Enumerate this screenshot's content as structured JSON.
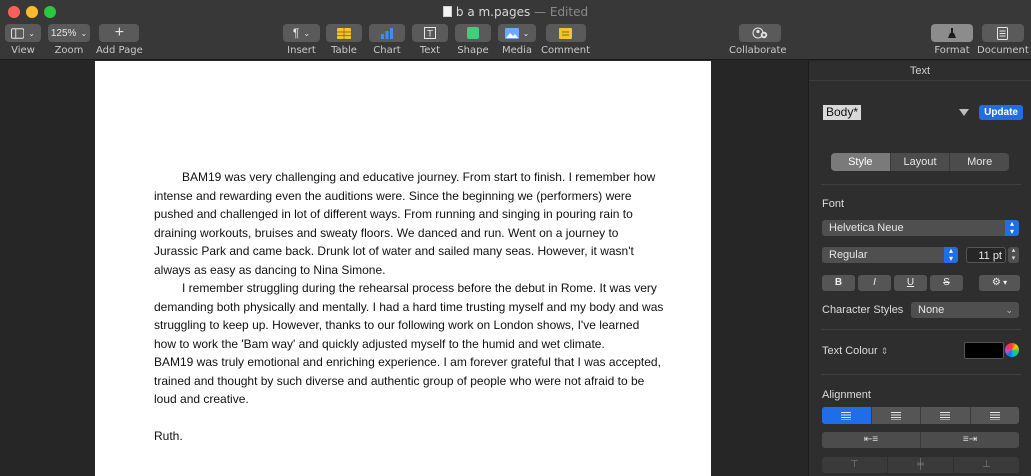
{
  "window": {
    "doc_name": "b a m.pages",
    "status": "— Edited"
  },
  "toolbar": {
    "view": {
      "label": "View",
      "icon": "sidebar-icon"
    },
    "zoom": {
      "label": "Zoom",
      "value": "125%"
    },
    "add_page": {
      "label": "Add Page",
      "icon": "plus-icon"
    },
    "insert": {
      "label": "Insert",
      "icon": "pilcrow-icon"
    },
    "table": {
      "label": "Table",
      "icon": "table-icon"
    },
    "chart": {
      "label": "Chart",
      "icon": "chart-icon"
    },
    "text": {
      "label": "Text",
      "icon": "text-box-icon"
    },
    "shape": {
      "label": "Shape",
      "icon": "shape-icon"
    },
    "media": {
      "label": "Media",
      "icon": "photo-icon"
    },
    "comment": {
      "label": "Comment",
      "icon": "comment-icon"
    },
    "collaborate": {
      "label": "Collaborate",
      "icon": "add-person-icon"
    },
    "format": {
      "label": "Format",
      "icon": "paintbrush-icon"
    },
    "document": {
      "label": "Document",
      "icon": "document-icon"
    }
  },
  "document": {
    "paragraphs": [
      {
        "text": "BAM19 was very challenging and educative journey. From start to finish. I remember how intense and rewarding even the auditions were. Since the beginning we (performers) were pushed and challenged in lot of different ways. From running and singing in pouring rain to draining workouts, bruises and sweaty floors. We danced and run. Went on a journey to Jurassic Park and came back. Drunk lot of water and sailed many seas. However, it wasn't always as easy as dancing to Nina Simone.",
        "indent": true
      },
      {
        "text": "I remember struggling during the rehearsal process before the debut in Rome. It was very demanding both physically and mentally. I had a hard time trusting myself and my body and was struggling to keep up. However, thanks to our following work on London shows, I've learned how to work the 'Bam way' and quickly adjusted myself to the humid and wet climate.",
        "indent": true
      },
      {
        "text": "BAM19 was truly emotional and enriching experience. I am forever grateful that I was accepted, trained and thought by such diverse and authentic group of people who were not afraid to be loud and creative.",
        "indent": false
      },
      {
        "text": "",
        "indent": false
      },
      {
        "text": "Ruth.",
        "indent": false
      }
    ]
  },
  "inspector": {
    "header": "Text",
    "paragraph_style": "Body*",
    "update_label": "Update",
    "tabs": [
      "Style",
      "Layout",
      "More"
    ],
    "active_tab": "Style",
    "font_section": "Font",
    "font_family": "Helvetica Neue",
    "font_weight": "Regular",
    "font_size": "11 pt",
    "format_buttons": [
      "B",
      "I",
      "U",
      "S"
    ],
    "char_styles_label": "Character Styles",
    "char_styles_value": "None",
    "text_colour_label": "Text Colour",
    "text_colour": "#000000",
    "alignment_label": "Alignment",
    "accent_color": "#1f6ee8"
  }
}
